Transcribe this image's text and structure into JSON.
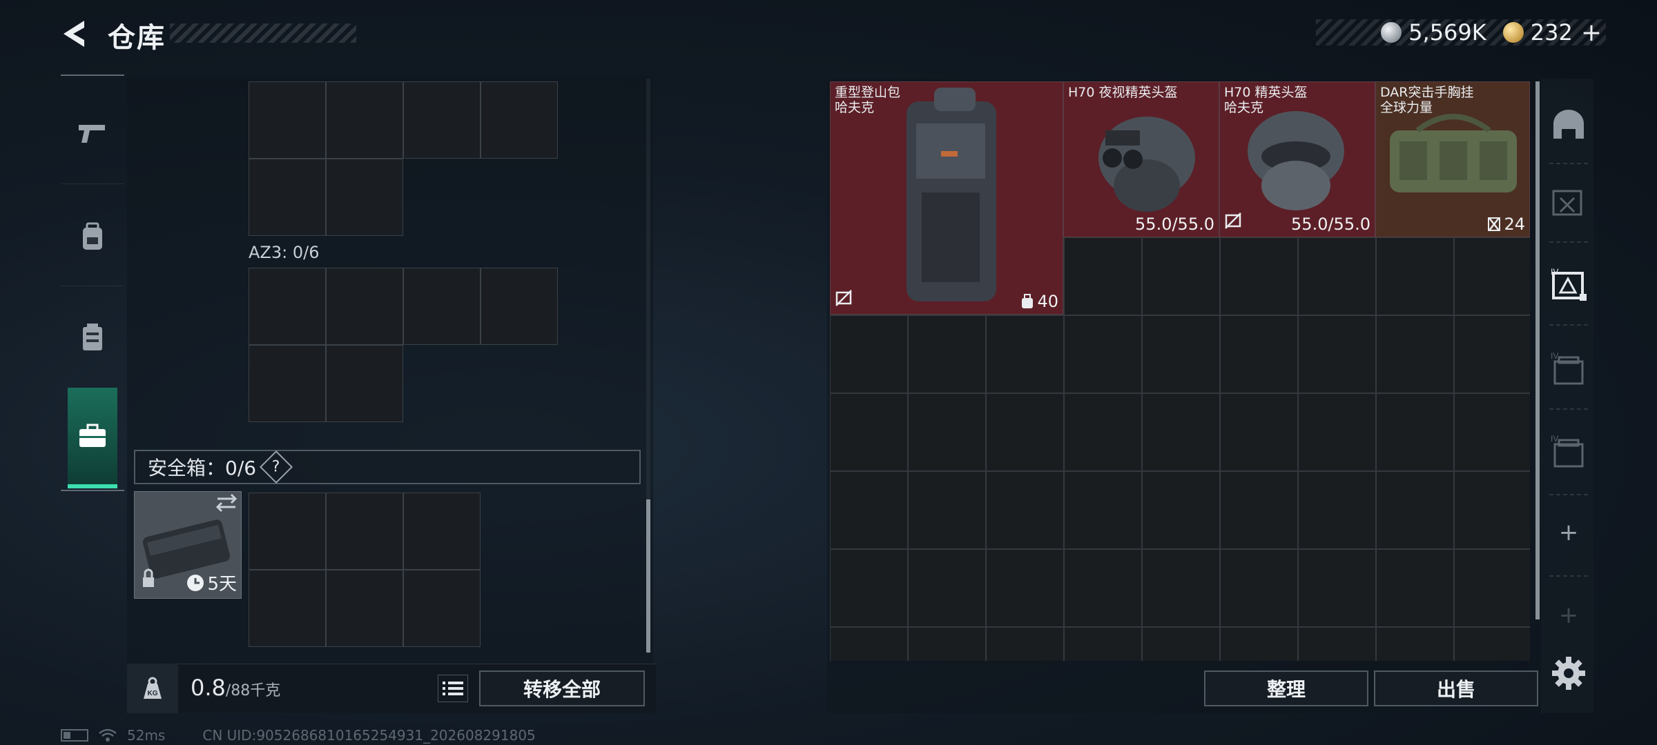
{
  "header": {
    "title": "仓库",
    "currency": [
      {
        "icon": "silver-coin-icon",
        "value": "5,569K"
      },
      {
        "icon": "gold-coin-icon",
        "value": "232"
      }
    ],
    "add_label": "+"
  },
  "left_tabs": [
    {
      "icon": "pistol-icon",
      "active": false
    },
    {
      "icon": "backpack-icon",
      "active": false
    },
    {
      "icon": "vest-icon",
      "active": false
    },
    {
      "icon": "briefcase-icon",
      "active": true
    }
  ],
  "storage": {
    "az3_label": "AZ3: 0/6",
    "safe_box_label": "安全箱：0/6",
    "help_label": "?",
    "safe_box_timer": "5天",
    "weight_current": "0.8",
    "weight_max": "/88千克",
    "kg_label": "KG",
    "transfer_all": "转移全部"
  },
  "items": [
    {
      "name": "重型登山包\n哈夫克",
      "stat": "40",
      "stat_icon": "capacity-icon",
      "color": "red",
      "corner_icon": "no-insure-icon"
    },
    {
      "name": "H70 夜视精英头盔",
      "stat": "55.0/55.0",
      "color": "red",
      "corner_icon": ""
    },
    {
      "name": "H70 精英头盔\n哈夫克",
      "stat": "55.0/55.0",
      "color": "red",
      "corner_icon": "no-insure-icon"
    },
    {
      "name": "DAR突击手胸挂\n全球力量",
      "stat": "24",
      "stat_icon": "capacity-icon",
      "color": "brown",
      "corner_icon": ""
    }
  ],
  "right_sidebar": {
    "icons": [
      "helmet-slot-icon",
      "armor-slot-icon",
      "rig-slot-icon",
      "case-slot-icon",
      "case2-slot-icon"
    ],
    "plus": "+"
  },
  "actions": {
    "organize": "整理",
    "sell": "出售"
  },
  "status": {
    "ping": "52ms",
    "uid": "CN UID:9052686810165254931_202608291805"
  }
}
